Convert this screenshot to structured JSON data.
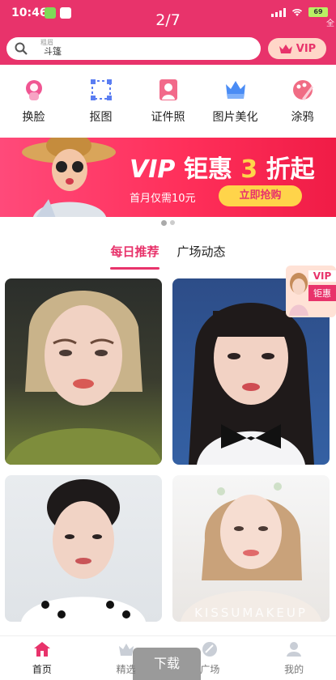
{
  "status_bar": {
    "time": "10:46",
    "battery": "69",
    "page_indicator": "2/7"
  },
  "corner_text": "全",
  "search": {
    "hint_top": "粗眉",
    "value": "斗篷"
  },
  "vip_button": {
    "label": "VIP"
  },
  "tools": [
    {
      "label": "换脸",
      "icon": "face-swap-icon",
      "color": "#f05592"
    },
    {
      "label": "抠图",
      "icon": "cutout-icon",
      "color": "#5a7df2"
    },
    {
      "label": "证件照",
      "icon": "id-photo-icon",
      "color": "#f26a8a"
    },
    {
      "label": "图片美化",
      "icon": "beautify-icon",
      "color": "#4a8cf5"
    },
    {
      "label": "涂鸦",
      "icon": "paint-icon",
      "color": "#f06c84"
    }
  ],
  "banner": {
    "title_vip": "VIP",
    "title_main": "钜惠",
    "title_num": "3",
    "title_tail": "折起",
    "subtitle": "首月仅需10元",
    "cta": "立即抢购"
  },
  "tabs": [
    {
      "label": "每日推荐",
      "active": true
    },
    {
      "label": "广场动态",
      "active": false
    }
  ],
  "watermark": "KISSUMAKEUP",
  "vip_float": {
    "line1": "VIP",
    "line2": "钜惠"
  },
  "bottom_nav": [
    {
      "label": "首页",
      "icon": "home-icon",
      "active": true
    },
    {
      "label": "精选",
      "icon": "featured-icon",
      "active": false
    },
    {
      "label": "广场",
      "icon": "square-icon",
      "active": false
    },
    {
      "label": "我的",
      "icon": "profile-icon",
      "active": false
    }
  ],
  "download_toast": "下载",
  "colors": {
    "accent": "#e8336b",
    "cta_yellow": "#ffd44a"
  }
}
